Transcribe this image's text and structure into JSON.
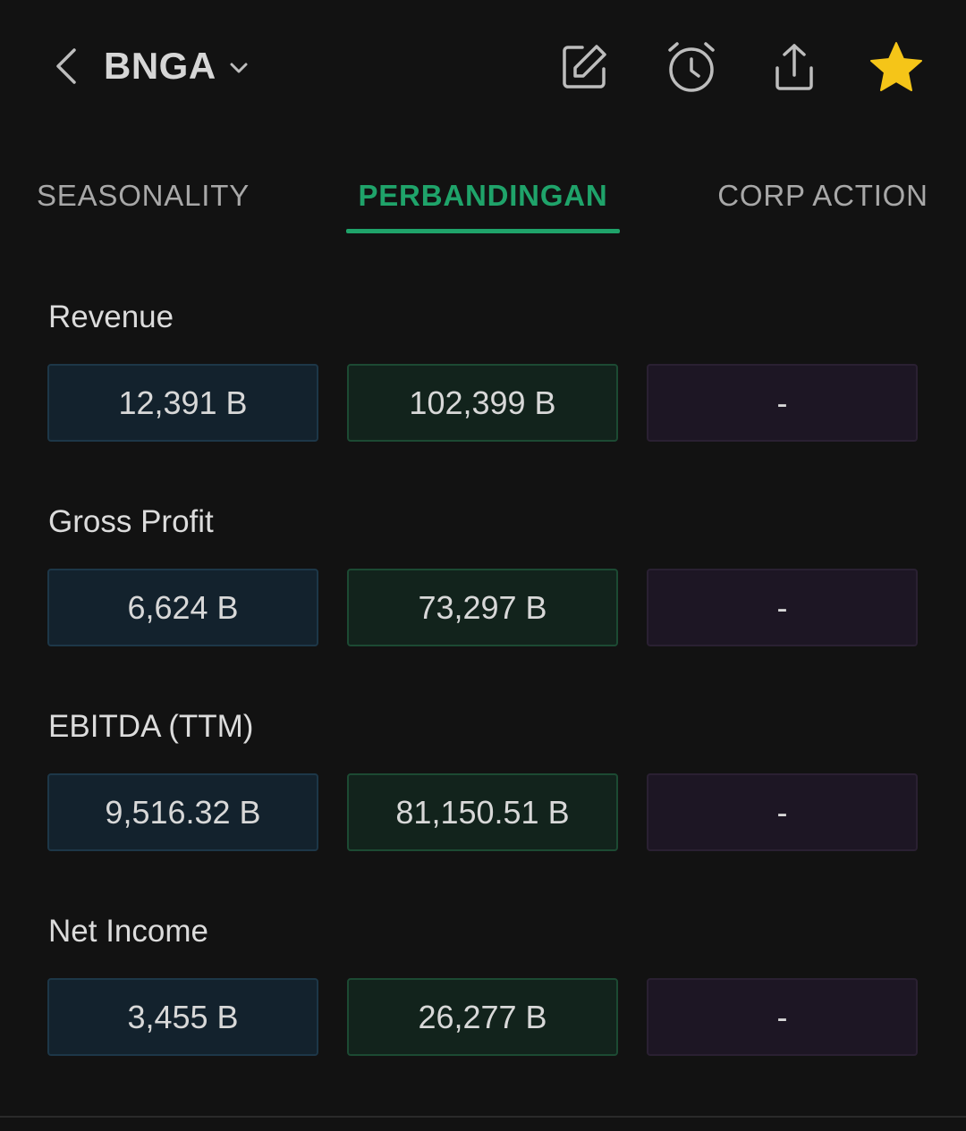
{
  "header": {
    "ticker": "BNGA",
    "icons": [
      "back-chevron-icon",
      "edit-icon",
      "alarm-icon",
      "share-icon",
      "star-icon"
    ],
    "star_color": "#f5c518"
  },
  "tabs": [
    {
      "label": "SEASONALITY",
      "active": false
    },
    {
      "label": "PERBANDINGAN",
      "active": true
    },
    {
      "label": "CORP ACTION",
      "active": false
    }
  ],
  "accent_color": "#1fa36a",
  "metrics": [
    {
      "label": "Revenue",
      "values": [
        "12,391 B",
        "102,399 B",
        "-"
      ]
    },
    {
      "label": "Gross Profit",
      "values": [
        "6,624 B",
        "73,297 B",
        "-"
      ]
    },
    {
      "label": "EBITDA (TTM)",
      "values": [
        "9,516.32 B",
        "81,150.51 B",
        "-"
      ]
    },
    {
      "label": "Net Income",
      "values": [
        "3,455 B",
        "26,277 B",
        "-"
      ]
    }
  ]
}
